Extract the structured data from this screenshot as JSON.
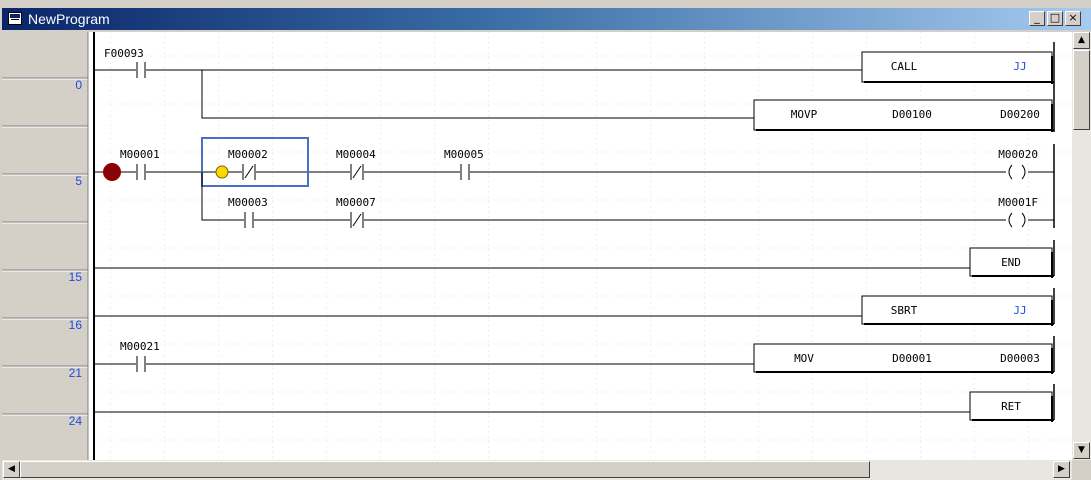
{
  "window": {
    "title": "NewProgram",
    "icon": "ladder-program-icon",
    "minimize_glyph": "_",
    "restore_glyph": "□",
    "close_glyph": "×"
  },
  "rungs": [
    {
      "step": "0",
      "contacts": [
        {
          "label": "F00093",
          "type": "normally-open"
        }
      ],
      "outputs": [
        {
          "instruction": "CALL",
          "operands": [
            "JJ"
          ]
        },
        {
          "instruction": "MOVP",
          "operands": [
            "D00100",
            "D00200"
          ]
        }
      ]
    },
    {
      "step": "5",
      "contacts": [
        {
          "label": "M00001",
          "type": "normally-open",
          "breakpoint": true
        },
        {
          "label": "M00002",
          "type": "normally-closed",
          "selected": true,
          "monitor": true
        },
        {
          "label": "M00004",
          "type": "normally-closed"
        },
        {
          "label": "M00005",
          "type": "normally-open"
        }
      ],
      "coil": "M00020",
      "branch": {
        "contacts": [
          {
            "label": "M00003",
            "type": "normally-open"
          },
          {
            "label": "M00007",
            "type": "normally-closed"
          }
        ],
        "coil": "M0001F"
      }
    },
    {
      "step": "15",
      "outputs": [
        {
          "instruction": "END",
          "operands": []
        }
      ]
    },
    {
      "step": "16",
      "outputs": [
        {
          "instruction": "SBRT",
          "operands": [
            "JJ"
          ]
        }
      ]
    },
    {
      "step": "21",
      "contacts": [
        {
          "label": "M00021",
          "type": "normally-open"
        }
      ],
      "outputs": [
        {
          "instruction": "MOV",
          "operands": [
            "D00001",
            "D00003"
          ]
        }
      ]
    },
    {
      "step": "24",
      "outputs": [
        {
          "instruction": "RET",
          "operands": []
        }
      ]
    }
  ],
  "colors": {
    "title_bar_start": "#0a246a",
    "title_bar_end": "#a6caf0",
    "step_number": "#1f4ae0",
    "breakpoint": "#8b0000",
    "monitor_indicator": "#ffd700",
    "selection_box": "#4a6fc8"
  }
}
